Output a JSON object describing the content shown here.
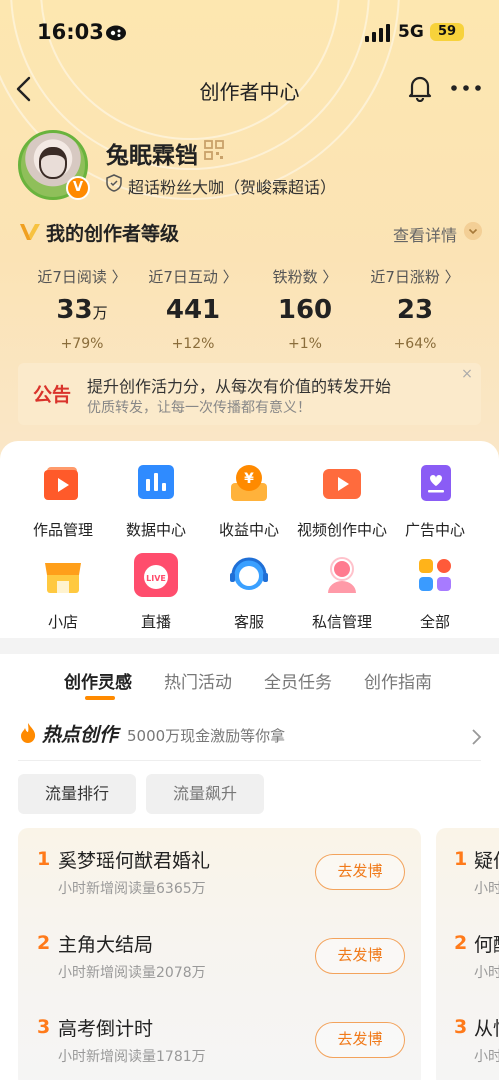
{
  "status_bar": {
    "time": "16:03",
    "network": "5G",
    "battery": "59"
  },
  "nav": {
    "title": "创作者中心"
  },
  "profile": {
    "name": "兔眠霖铛",
    "verified_badge": "V",
    "fan_title": "超话粉丝大咖（贺峻霖超话）"
  },
  "level": {
    "title": "我的创作者等级",
    "detail_link": "查看详情"
  },
  "stats": [
    {
      "label": "近7日阅读 〉",
      "value": "33",
      "unit": "万",
      "change": "+79%"
    },
    {
      "label": "近7日互动 〉",
      "value": "441",
      "unit": "",
      "change": "+12%"
    },
    {
      "label": "铁粉数 〉",
      "value": "160",
      "unit": "",
      "change": "+1%"
    },
    {
      "label": "近7日涨粉 〉",
      "value": "23",
      "unit": "",
      "change": "+64%"
    }
  ],
  "notice": {
    "tag": "公告",
    "main": "提升创作活力分，从每次有价值的转发开始",
    "sub": "优质转发，让每一次传播都有意义！",
    "close": "×"
  },
  "tools": [
    {
      "label": "作品管理",
      "icon": "works-icon"
    },
    {
      "label": "数据中心",
      "icon": "data-center-icon"
    },
    {
      "label": "收益中心",
      "icon": "revenue-icon"
    },
    {
      "label": "视频创作中心",
      "icon": "video-icon"
    },
    {
      "label": "广告中心",
      "icon": "ad-icon"
    },
    {
      "label": "小店",
      "icon": "shop-icon"
    },
    {
      "label": "直播",
      "icon": "live-icon",
      "badge": "LIVE"
    },
    {
      "label": "客服",
      "icon": "customer-service-icon"
    },
    {
      "label": "私信管理",
      "icon": "message-icon"
    },
    {
      "label": "全部",
      "icon": "all-icon"
    }
  ],
  "tabs": [
    {
      "label": "创作灵感",
      "active": true
    },
    {
      "label": "热门活动",
      "active": false
    },
    {
      "label": "全员任务",
      "active": false
    },
    {
      "label": "创作指南",
      "active": false
    }
  ],
  "hot": {
    "title": "热点创作",
    "subtitle": "5000万现金激励等你拿"
  },
  "chips": [
    {
      "label": "流量排行",
      "active": true
    },
    {
      "label": "流量飙升",
      "active": false
    }
  ],
  "ranking": [
    {
      "num": "1",
      "title": "奚梦瑶何猷君婚礼",
      "meta": "小时新增阅读量6365万",
      "button": "去发博"
    },
    {
      "num": "2",
      "title": "主角大结局",
      "meta": "小时新增阅读量2078万",
      "button": "去发博"
    },
    {
      "num": "3",
      "title": "高考倒计时",
      "meta": "小时新增阅读量1781万",
      "button": "去发博"
    }
  ],
  "ranking_peek": [
    {
      "num": "1",
      "title": "疑伯",
      "meta": "小时"
    },
    {
      "num": "2",
      "title": "何酮",
      "meta": "小时"
    },
    {
      "num": "3",
      "title": "从忖",
      "meta": "小时"
    }
  ],
  "colors": {
    "accent": "#ff8a00",
    "notice_tag": "#d9332b",
    "header_bg": "#fde7b0"
  }
}
